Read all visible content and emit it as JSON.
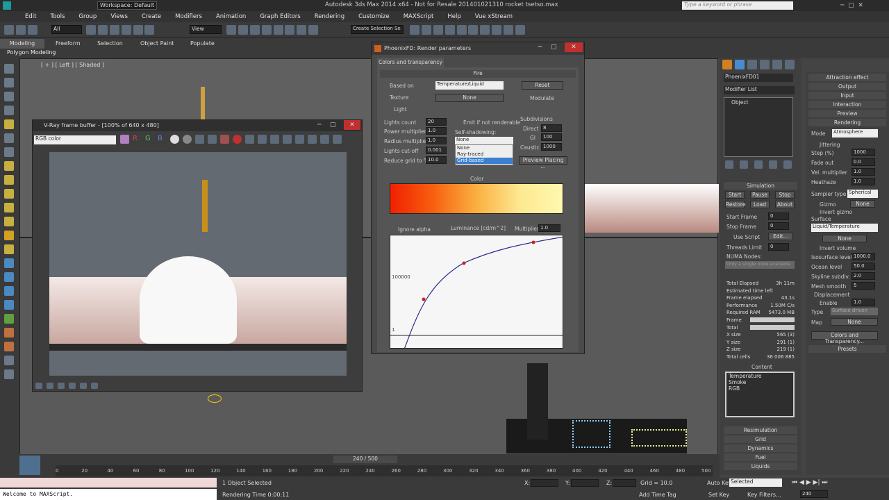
{
  "title_bar": {
    "workspace": "Workspace: Default",
    "app_title": "Autodesk 3ds Max 2014 x64 - Not for Resale  201401021310 rocket tsetso.max",
    "search_placeholder": "Type a keyword or phrase"
  },
  "menu": [
    "Edit",
    "Tools",
    "Group",
    "Views",
    "Create",
    "Modifiers",
    "Animation",
    "Graph Editors",
    "Rendering",
    "Customize",
    "MAXScript",
    "Help",
    "Vue xStream"
  ],
  "toolbar": {
    "selection_filter": "All",
    "ref_coord": "View",
    "named_sel": "Create Selection Se"
  },
  "ribbon": {
    "tabs": [
      "Modeling",
      "Freeform",
      "Selection",
      "Object Paint",
      "Populate"
    ],
    "subtitle": "Polygon Modeling"
  },
  "viewport": {
    "label": "[ + ] [ Left ] [ Shaded ]"
  },
  "vfb": {
    "title": "V-Ray frame buffer - [100% of 640 x 480]",
    "channel": "RGB color"
  },
  "phoenix": {
    "title": "PhoenixFD: Render parameters",
    "tab": "Colors and transparency",
    "section_fire": "Fire",
    "based_on_label": "Based on",
    "based_on_value": "Temperature/Liquid",
    "reset": "Reset",
    "texture_label": "Texture",
    "texture_value": "None",
    "modulate": "Modulate",
    "light": "Light",
    "lights_count_label": "Lights count",
    "lights_count": "20",
    "power_mult_label": "Power multiplier",
    "power_mult": "1.0",
    "radius_mult_label": "Radius multiplier",
    "radius_mult": "1.0",
    "cutoff_label": "Lights cut-off",
    "cutoff": "0.001",
    "reduce_label": "Reduce grid to %",
    "reduce": "10.0",
    "emit_label": "Emit if not renderable",
    "self_shadow_label": "Self-shadowing:",
    "self_shadow_value": "None",
    "self_shadow_options": [
      "None",
      "Ray-traced",
      "Grid-based"
    ],
    "subdiv_label": "Subdivisions",
    "direct_label": "Direct",
    "direct": "8",
    "gi_label": "GI",
    "gi": "100",
    "caustic_label": "Caustic",
    "caustic": "1000",
    "preview_placing": "Preview Placing ...",
    "color_label": "Color",
    "ignore_alpha": "Ignore alpha",
    "luminance_label": "Luminance [cd/m^2]",
    "multiplier_label": "Multiplier",
    "multiplier": "1.0",
    "curve_tick": "100000",
    "curve_tick_low": "1"
  },
  "cmd": {
    "object_name": "PhoenixFD01",
    "modifier_list": "Modifier List",
    "stack_item": "Object",
    "simulation_header": "Simulation",
    "start": "Start",
    "pause": "Pause",
    "stop": "Stop",
    "restore": "Restore",
    "load": "Load",
    "about": "About",
    "start_frame_label": "Start Frame",
    "start_frame": "0",
    "stop_frame_label": "Stop Frame",
    "stop_frame": "0",
    "use_script": "Use Script",
    "edit": "Edit...",
    "threads_label": "Threads Limit",
    "threads": "0",
    "numa_label": "NUMA Nodes:",
    "numa_value": "Only a single node available",
    "stats": [
      [
        "Total Elapsed",
        "3h 11m"
      ],
      [
        "Estimated time left",
        ""
      ],
      [
        "Frame elapsed",
        "43.1s"
      ],
      [
        "Performance",
        "1.50M C/s"
      ],
      [
        "Required RAM",
        "5473.0 MB"
      ],
      [
        "Frame",
        ""
      ],
      [
        "Total",
        ""
      ],
      [
        "X size",
        "565 (3)"
      ],
      [
        "Y size",
        "291 (1)"
      ],
      [
        "Z size",
        "219 (1)"
      ],
      [
        "Total cells",
        "36 006 885"
      ]
    ],
    "content_label": "Content",
    "content_items": [
      "Temperature",
      "Smoke",
      "RGB"
    ],
    "rollouts": [
      "Resimulation",
      "Grid",
      "Dynamics",
      "Fuel",
      "Liquids"
    ]
  },
  "right": {
    "sections": [
      "Attraction effect",
      "Output",
      "Input",
      "Interaction",
      "Preview",
      "Rendering"
    ],
    "mode_label": "Mode",
    "mode": "Atmosphere",
    "jittering": "Jittering",
    "step_label": "Step (%)",
    "step": "1000",
    "fade_label": "Fade out",
    "fade": "0.0",
    "vel_label": "Vel. multiplier",
    "vel": "1.0",
    "heat_label": "Heathaze",
    "heat": "1.0",
    "sampler_label": "Sampler type",
    "sampler": "Spherical",
    "gizmo": "Gizmo",
    "gizmo_val": "None",
    "invert_gizmo": "Invert gizmo",
    "surface_label": "Surface",
    "surface_value": "Liquid/Temperature",
    "surface_none": "None",
    "invert_volume": "Invert volume",
    "iso_label": "Isosurface level",
    "iso": "1000.0",
    "ocean_label": "Ocean level",
    "ocean": "50.0",
    "skyline_label": "Skyline subdiv.",
    "skyline": "2.0",
    "mesh_label": "Mesh smooth",
    "mesh": "5",
    "displacement": "Displacement",
    "enable": "Enable",
    "disp_val": "1.0",
    "type_label": "Type",
    "type_value": "Surface driven",
    "map_label": "Map",
    "map_value": "None",
    "colors_btn": "Colors and Transparency...",
    "presets": "Presets"
  },
  "timeline": {
    "frame": "240 / 500",
    "ticks": [
      "0",
      "20",
      "40",
      "60",
      "80",
      "100",
      "120",
      "140",
      "160",
      "180",
      "200",
      "220",
      "240",
      "260",
      "280",
      "300",
      "320",
      "340",
      "360",
      "380",
      "400",
      "420",
      "440",
      "460",
      "480",
      "500"
    ]
  },
  "status": {
    "maxscript": "Welcome to MAXScript.",
    "selected": "1 Object Selected",
    "render_time": "Rendering Time  0:00:11",
    "x": "X:",
    "y": "Y:",
    "z": "Z:",
    "grid": "Grid = 10.0",
    "add_time_tag": "Add Time Tag",
    "auto_key": "Auto Key",
    "set_key": "Set Key",
    "selected_dd": "Selected",
    "key_filters": "Key Filters...",
    "frame": "240"
  }
}
